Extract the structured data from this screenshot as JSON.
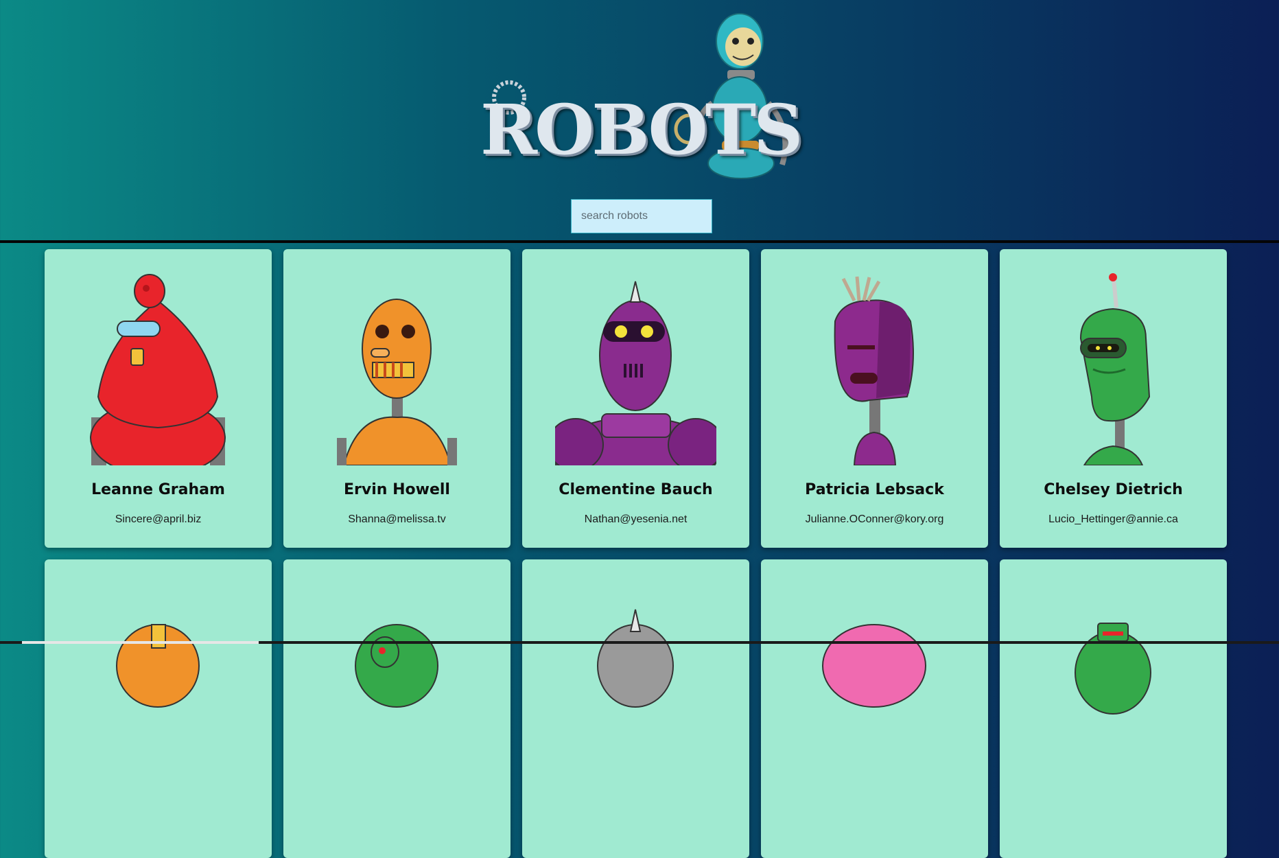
{
  "header": {
    "logo_text": "ROBOTS",
    "search_placeholder": "search robots",
    "search_value": ""
  },
  "robots": [
    {
      "name": "Leanne Graham",
      "email": "Sincere@april.biz",
      "color": "#e8242b"
    },
    {
      "name": "Ervin Howell",
      "email": "Shanna@melissa.tv",
      "color": "#f0922a"
    },
    {
      "name": "Clementine Bauch",
      "email": "Nathan@yesenia.net",
      "color": "#8a2c8e"
    },
    {
      "name": "Patricia Lebsack",
      "email": "Julianne.OConner@kory.org",
      "color": "#8d2a8d"
    },
    {
      "name": "Chelsey Dietrich",
      "email": "Lucio_Hettinger@annie.ca",
      "color": "#34a94a"
    }
  ],
  "colors": {
    "card_bg": "#a0ead1",
    "search_bg": "#cdeefb"
  }
}
